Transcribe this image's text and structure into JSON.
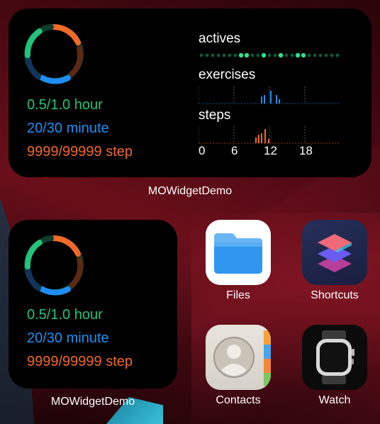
{
  "colors": {
    "hour": "#22c37a",
    "minute": "#1e8ef2",
    "step": "#f06a28",
    "actives_dot": "#0e5a3a",
    "actives_dot_active": "#2fe08f"
  },
  "large_widget": {
    "caption": "MOWidgetDemo",
    "stats": {
      "hour": "0.5/1.0 hour",
      "minute": "20/30 minute",
      "step": "9999/99999 step"
    },
    "progress": {
      "hour": 0.5,
      "minute": 0.6667,
      "step": 0.1
    },
    "charts": {
      "actives_label": "actives",
      "exercises_label": "exercises",
      "steps_label": "steps",
      "hour_ticks": [
        "0",
        "6",
        "12",
        "18"
      ]
    }
  },
  "small_widget": {
    "caption": "MOWidgetDemo",
    "stats": {
      "hour": "0.5/1.0 hour",
      "minute": "20/30 minute",
      "step": "9999/99999 step"
    }
  },
  "apps": [
    {
      "label": "Files",
      "icon": "files-folder-icon"
    },
    {
      "label": "Shortcuts",
      "icon": "shortcuts-layers-icon"
    },
    {
      "label": "Contacts",
      "icon": "contacts-person-icon"
    },
    {
      "label": "Watch",
      "icon": "apple-watch-icon"
    }
  ]
}
